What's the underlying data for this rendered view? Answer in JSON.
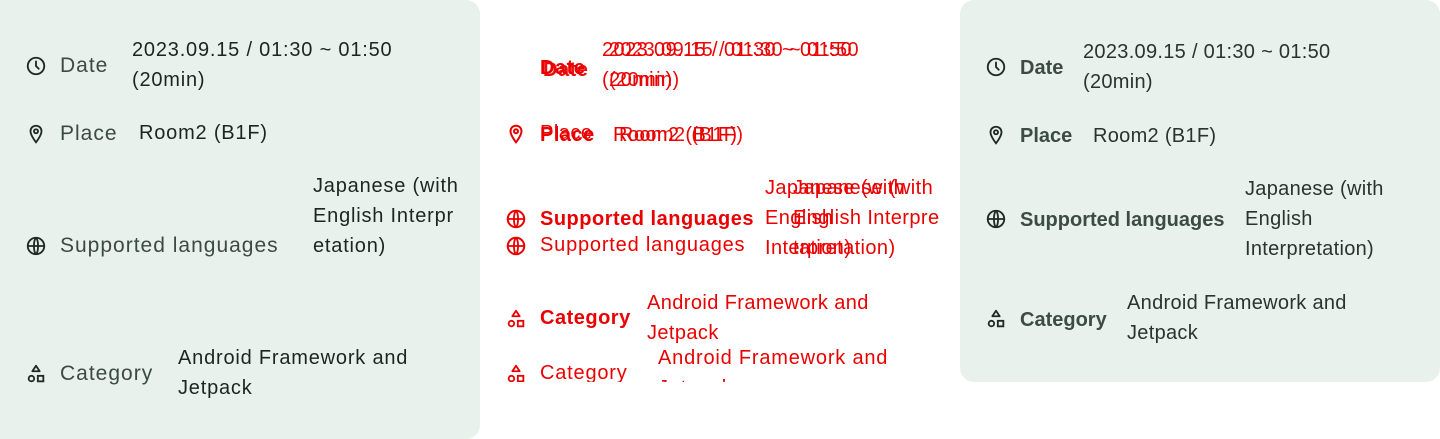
{
  "session_info": {
    "date": {
      "label": "Date",
      "value": "2023.09.15 / 01:30 ~ 01:50 (20min)",
      "icon": "clock-icon"
    },
    "place": {
      "label": "Place",
      "value": "Room2 (B1F)",
      "icon": "location-pin-icon"
    },
    "languages": {
      "label": "Supported languages",
      "value": "Japanese (with English Interpretation)",
      "icon": "globe-icon"
    },
    "category": {
      "label": "Category",
      "value": "Android Framework and Jetpack",
      "icon": "shapes-icon"
    }
  },
  "colors": {
    "card_background": "#e9f1ec",
    "text_label": "#3c4a44",
    "text_value": "#1c2521",
    "debug_overlay": "#ea0000"
  }
}
